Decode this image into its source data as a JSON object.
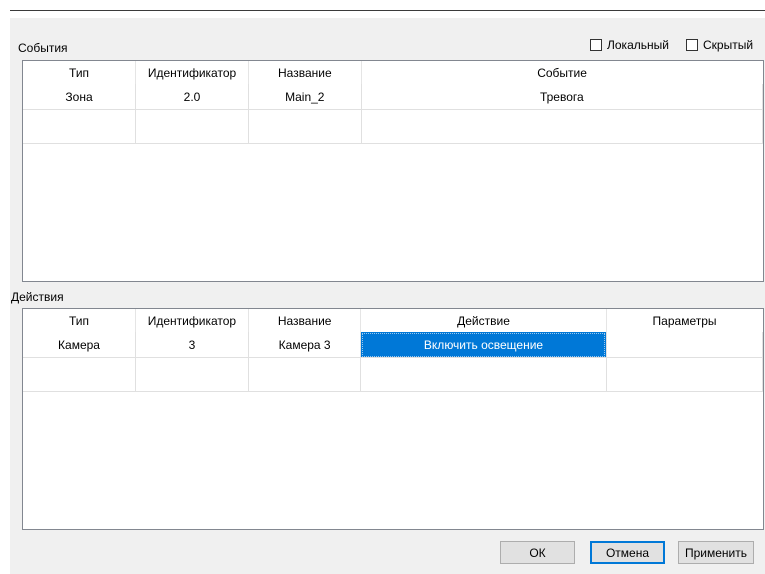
{
  "events": {
    "label": "События",
    "local_label": "Локальный",
    "hidden_label": "Скрытый",
    "columns": [
      "Тип",
      "Идентификатор",
      "Название",
      "Событие"
    ],
    "rows": [
      [
        "Зона",
        "2.0",
        "Main_2",
        "Тревога"
      ],
      [
        "",
        "",
        "",
        ""
      ]
    ]
  },
  "actions": {
    "label": "Действия",
    "columns": [
      "Тип",
      "Идентификатор",
      "Название",
      "Действие",
      "Параметры"
    ],
    "rows": [
      [
        "Камера",
        "3",
        "Камера 3",
        "Включить освещение",
        ""
      ],
      [
        "",
        "",
        "",
        "",
        ""
      ]
    ]
  },
  "buttons": {
    "ok": "ОК",
    "cancel": "Отмена",
    "apply": "Применить"
  },
  "colors": {
    "selection": "#0078d7",
    "default_button_border": "#0078d7"
  }
}
